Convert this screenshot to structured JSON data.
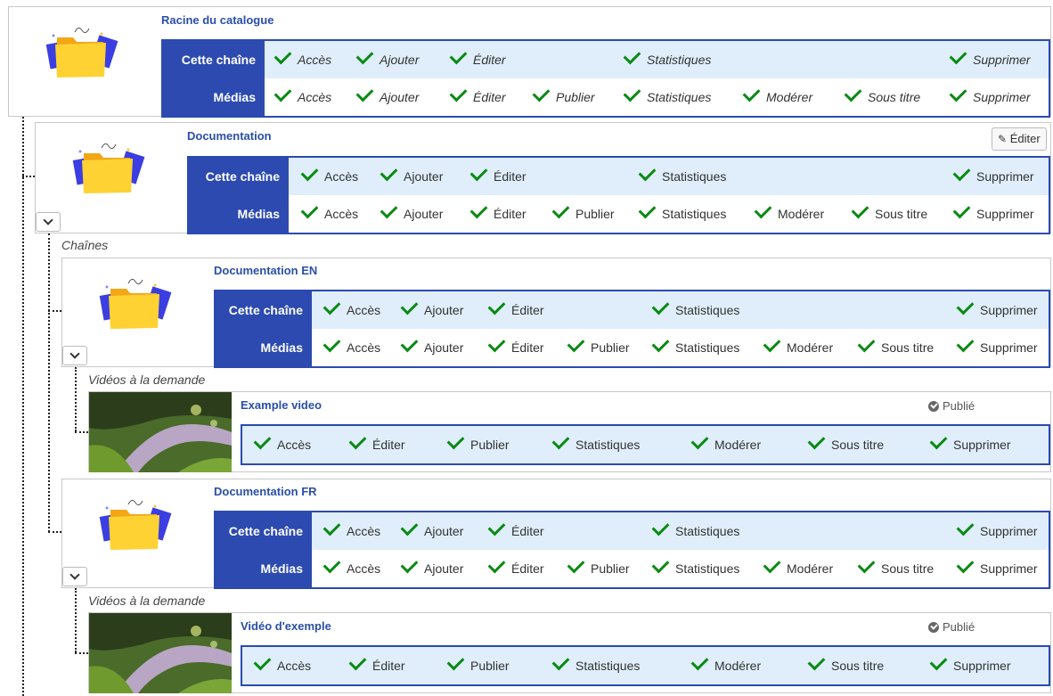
{
  "labels": {
    "channel": "Cette chaîne",
    "media": "Médias"
  },
  "perms": {
    "access": "Accès",
    "add": "Ajouter",
    "edit": "Éditer",
    "publish": "Publier",
    "stats": "Statistiques",
    "moderate": "Modérer",
    "subtitle": "Sous titre",
    "delete": "Supprimer"
  },
  "root": {
    "title": "Racine du catalogue"
  },
  "documentation": {
    "title": "Documentation",
    "edit_button": "Éditer"
  },
  "sections": {
    "chains": "Chaînes",
    "vod": "Vidéos à la demande"
  },
  "doc_en": {
    "title": "Documentation EN"
  },
  "video_en": {
    "title": "Example video",
    "status": "Publié"
  },
  "doc_fr": {
    "title": "Documentation FR"
  },
  "video_fr": {
    "title": "Vidéo d'exemple",
    "status": "Publié"
  },
  "colors": {
    "accent": "#2c4aaf",
    "row_alt": "#dfeefa",
    "check": "#0a8a13",
    "title": "#2a4fa8"
  }
}
